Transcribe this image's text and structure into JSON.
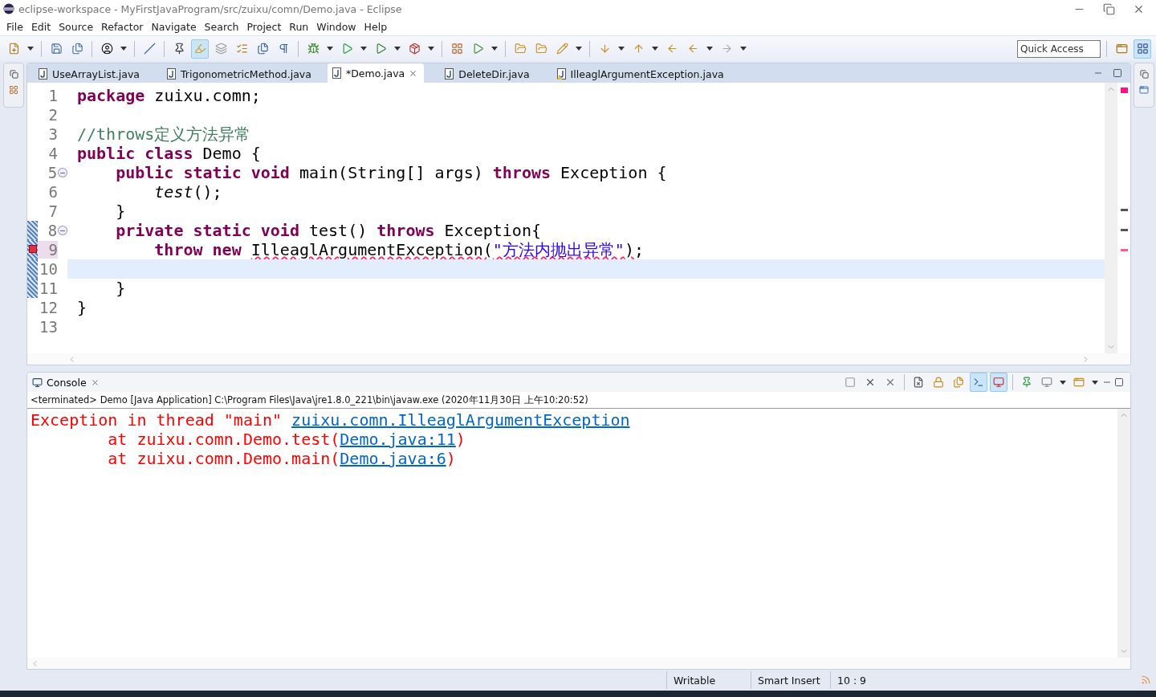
{
  "window": {
    "title": "eclipse-workspace - MyFirstJavaProgram/src/zuixu/comn/Demo.java - Eclipse"
  },
  "menu": [
    "File",
    "Edit",
    "Source",
    "Refactor",
    "Navigate",
    "Search",
    "Project",
    "Run",
    "Window",
    "Help"
  ],
  "quick_access": {
    "placeholder": "Quick Access"
  },
  "editor_tabs": [
    {
      "label": "UseArrayList.java",
      "selected": false,
      "warning": false
    },
    {
      "label": "TrigonometricMethod.java",
      "selected": false,
      "warning": false
    },
    {
      "label": "*Demo.java",
      "selected": true,
      "warning": false
    },
    {
      "label": "DeleteDir.java",
      "selected": false,
      "warning": false
    },
    {
      "label": "IlleaglArgumentException.java",
      "selected": false,
      "warning": true
    }
  ],
  "code_lines": [
    {
      "number": "1",
      "current": false,
      "error": false,
      "foldable": false,
      "changed": false,
      "tokens": [
        {
          "kind": "keyword",
          "text": "package"
        },
        {
          "kind": "plain",
          "text": " zuixu.comn;"
        }
      ]
    },
    {
      "number": "2",
      "current": false,
      "error": false,
      "foldable": false,
      "changed": false
    },
    {
      "number": "3",
      "current": false,
      "error": false,
      "foldable": false,
      "changed": false,
      "tokens": [
        {
          "kind": "comment",
          "text": "//throws定义方法异常"
        }
      ]
    },
    {
      "number": "4",
      "current": false,
      "error": false,
      "foldable": false,
      "changed": false,
      "tokens": [
        {
          "kind": "keyword",
          "text": "public class"
        },
        {
          "kind": "plain",
          "text": " Demo {"
        }
      ]
    },
    {
      "number": "5",
      "current": false,
      "error": false,
      "foldable": true,
      "changed": false,
      "tokens": [
        {
          "kind": "keyword",
          "text": "    public static void"
        },
        {
          "kind": "plain",
          "text": " main(String[] args) "
        },
        {
          "kind": "keyword",
          "text": "throws"
        },
        {
          "kind": "plain",
          "text": " Exception {"
        }
      ]
    },
    {
      "number": "6",
      "current": false,
      "error": false,
      "foldable": false,
      "changed": false,
      "tokens": [
        {
          "kind": "italic",
          "text": "        test"
        },
        {
          "kind": "plain",
          "text": "();"
        }
      ]
    },
    {
      "number": "7",
      "current": false,
      "error": false,
      "foldable": false,
      "changed": false,
      "tokens": [
        {
          "kind": "plain",
          "text": "    }"
        }
      ]
    },
    {
      "number": "8",
      "current": false,
      "error": false,
      "foldable": true,
      "changed": true,
      "tokens": [
        {
          "kind": "keyword",
          "text": "    private static void"
        },
        {
          "kind": "plain",
          "text": " test() "
        },
        {
          "kind": "keyword",
          "text": "throws"
        },
        {
          "kind": "plain",
          "text": " Exception{"
        }
      ]
    },
    {
      "number": "9",
      "current": false,
      "error": true,
      "foldable": false,
      "changed": true,
      "tokens": [
        {
          "kind": "keyword",
          "text": "        throw new "
        },
        {
          "kind": "squiggle",
          "text": "IlleaglArgumentException("
        },
        {
          "kind": "string",
          "text": "\"方法内抛出异常\""
        },
        {
          "kind": "squiggle",
          "text": ")"
        },
        {
          "kind": "plain",
          "text": ";"
        }
      ]
    },
    {
      "number": "10",
      "current": true,
      "error": false,
      "foldable": false,
      "changed": true
    },
    {
      "number": "11",
      "current": false,
      "error": false,
      "foldable": false,
      "changed": true,
      "tokens": [
        {
          "kind": "plain",
          "text": "    }"
        }
      ]
    },
    {
      "number": "12",
      "current": false,
      "error": false,
      "foldable": false,
      "changed": false,
      "tokens": [
        {
          "kind": "plain",
          "text": "}"
        }
      ]
    },
    {
      "number": "13",
      "current": false,
      "error": false,
      "foldable": false,
      "changed": false
    }
  ],
  "console": {
    "title": "Console",
    "process": "<terminated> Demo [Java Application] C:\\Program Files\\Java\\jre1.8.0_221\\bin\\javaw.exe (2020年11月30日 上午10:20:52)",
    "lines": [
      {
        "segments": [
          {
            "kind": "text",
            "text": "Exception in thread \"main\" "
          },
          {
            "kind": "link",
            "text": "zuixu.comn.IlleaglArgumentException"
          }
        ]
      },
      {
        "segments": [
          {
            "kind": "text",
            "text": "        at zuixu.comn.Demo.test("
          },
          {
            "kind": "link",
            "text": "Demo.java:11"
          },
          {
            "kind": "text",
            "text": ")"
          }
        ]
      },
      {
        "segments": [
          {
            "kind": "text",
            "text": "        at zuixu.comn.Demo.main("
          },
          {
            "kind": "link",
            "text": "Demo.java:6"
          },
          {
            "kind": "text",
            "text": ")"
          }
        ]
      }
    ]
  },
  "status_bar": [
    "Writable",
    "Smart Insert",
    "10 : 9"
  ]
}
